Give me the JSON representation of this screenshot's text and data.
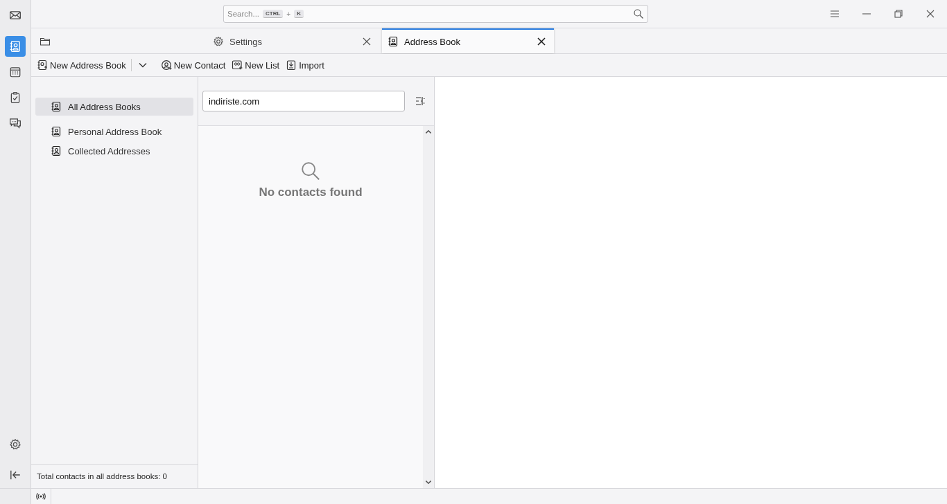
{
  "spaces": [
    {
      "kind": "mail",
      "selected": false
    },
    {
      "kind": "addressbook",
      "selected": true
    },
    {
      "kind": "calendar",
      "selected": false
    },
    {
      "kind": "tasks",
      "selected": false
    },
    {
      "kind": "chat",
      "selected": false
    }
  ],
  "spaces_bottom": [
    {
      "kind": "settings"
    },
    {
      "kind": "collapse"
    }
  ],
  "search": {
    "placeholder": "Search...",
    "keys": [
      "CTRL",
      "K"
    ],
    "joiner": "+"
  },
  "tabs": [
    {
      "kind": "folder",
      "selected": false,
      "closable": false
    },
    {
      "kind": "settings",
      "label": "Settings",
      "selected": false,
      "closable": true
    },
    {
      "kind": "addressbook",
      "label": "Address Book",
      "selected": true,
      "closable": true
    }
  ],
  "toolbar": [
    {
      "kind": "newbook",
      "label": "New Address Book"
    },
    {
      "kind": "dropdown"
    },
    {
      "kind": "newcontact",
      "label": "New Contact"
    },
    {
      "kind": "newlist",
      "label": "New List"
    },
    {
      "kind": "import",
      "label": "Import"
    }
  ],
  "books": {
    "items": [
      {
        "label": "All Address Books",
        "selected": true
      },
      {
        "label": "Personal Address Book",
        "selected": false
      },
      {
        "label": "Collected Addresses",
        "selected": false
      }
    ],
    "footer": "Total contacts in all address books: 0"
  },
  "contacts": {
    "search_value": "indiriste.com",
    "empty_message": "No contacts found"
  }
}
